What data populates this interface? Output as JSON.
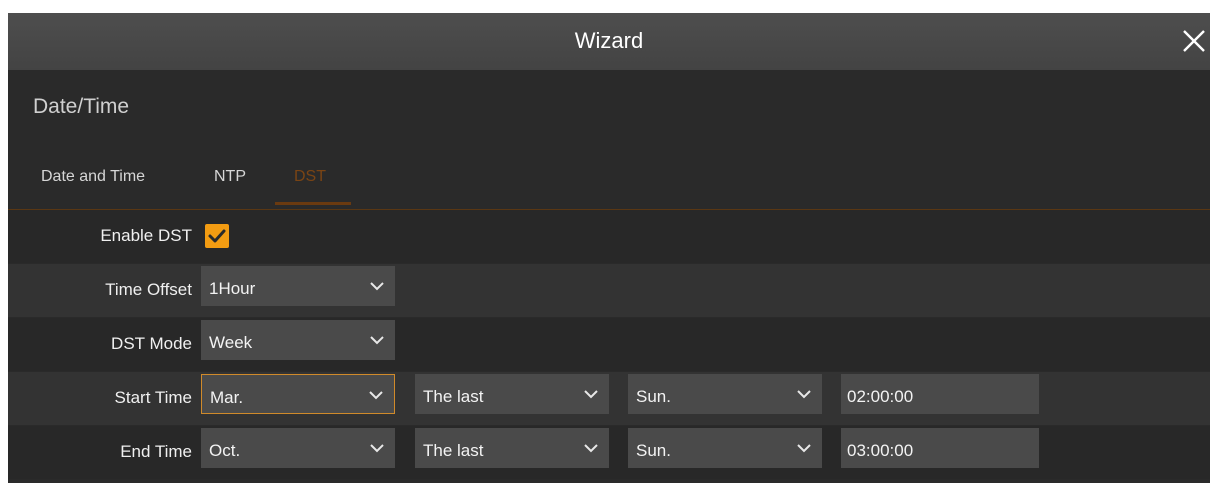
{
  "window": {
    "title": "Wizard"
  },
  "section": {
    "title": "Date/Time"
  },
  "tabs": [
    {
      "label": "Date and Time"
    },
    {
      "label": "NTP"
    },
    {
      "label": "DST",
      "active": true
    }
  ],
  "form": {
    "enable_dst": {
      "label": "Enable DST",
      "checked": true
    },
    "time_offset": {
      "label": "Time Offset",
      "value": "1Hour"
    },
    "dst_mode": {
      "label": "DST Mode",
      "value": "Week"
    },
    "start_time": {
      "label": "Start Time",
      "month": "Mar.",
      "week": "The last",
      "day": "Sun.",
      "time": "02:00:00"
    },
    "end_time": {
      "label": "End Time",
      "month": "Oct.",
      "week": "The last",
      "day": "Sun.",
      "time": "03:00:00"
    }
  },
  "colors": {
    "accent": "#f39c12",
    "active_tab": "#7a4414"
  },
  "icons": {
    "close": "close-icon",
    "dropdown": "chevron-down-icon",
    "check": "checkmark-icon"
  }
}
